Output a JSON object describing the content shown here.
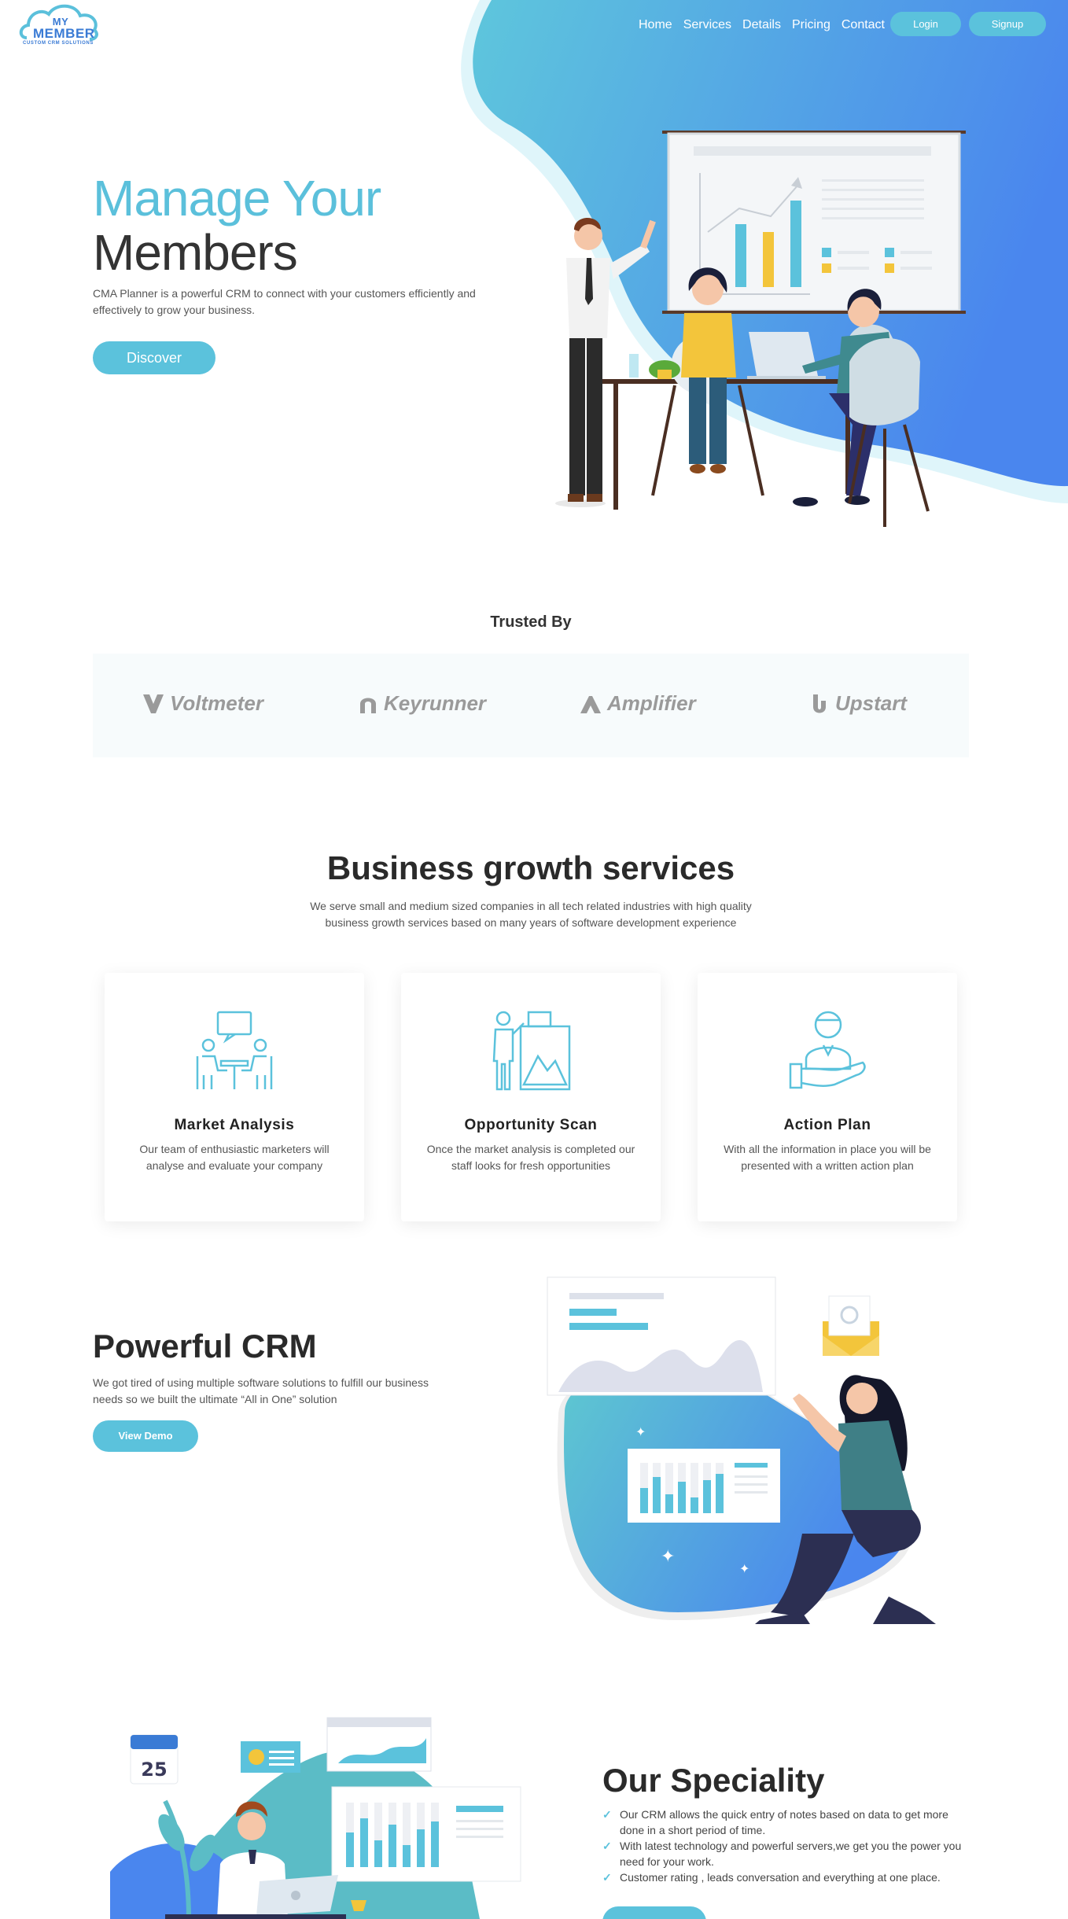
{
  "header": {
    "logo_text_top": "MY",
    "logo_text_main": "MEMBER",
    "logo_tagline": "CUSTOM CRM SOLUTIONS",
    "nav": [
      "Home",
      "Services",
      "Details",
      "Pricing",
      "Contact"
    ],
    "login_label": "Login",
    "signup_label": "Signup"
  },
  "hero": {
    "title_line1": "Manage Your",
    "title_line2": "Members",
    "subtitle": "CMA Planner is a powerful CRM to connect with your customers efficiently and effectively to grow your business.",
    "cta_label": "Discover"
  },
  "trusted": {
    "title": "Trusted By",
    "brands": [
      "Voltmeter",
      "Keyrunner",
      "Amplifier",
      "Upstart"
    ]
  },
  "services": {
    "title": "Business growth services",
    "subtitle": "We serve small and medium sized companies in all tech related industries with high quality business growth services based on many years of software development experience",
    "cards": [
      {
        "icon": "meeting-icon",
        "title": "Market Analysis",
        "text": "Our team of enthusiastic marketers will analyse and evaluate your company"
      },
      {
        "icon": "presentation-icon",
        "title": "Opportunity Scan",
        "text": "Once the market analysis is completed our staff looks for fresh opportunities"
      },
      {
        "icon": "handshake-person-icon",
        "title": "Action Plan",
        "text": "With all the information in place you will be presented with a written action plan"
      }
    ]
  },
  "crm": {
    "title": "Powerful CRM",
    "subtitle": "We got tired of using multiple software solutions to fulfill our business needs so we built the ultimate “All in One” solution",
    "cta_label": "View Demo"
  },
  "speciality": {
    "title": "Our Speciality",
    "calendar_day": "25",
    "items": [
      "Our CRM allows the quick entry of notes based on data to get more done in a short period of time.",
      "With latest technology and powerful servers,we get you the power you need for your work.",
      "Customer rating , leads conversation and everything at one place."
    ]
  },
  "colors": {
    "accent": "#5bc2dc",
    "gradient_start": "#5ec8d8",
    "gradient_end": "#4a86ee",
    "dark_text": "#2a2a2a",
    "yellow": "#f3c53b"
  }
}
